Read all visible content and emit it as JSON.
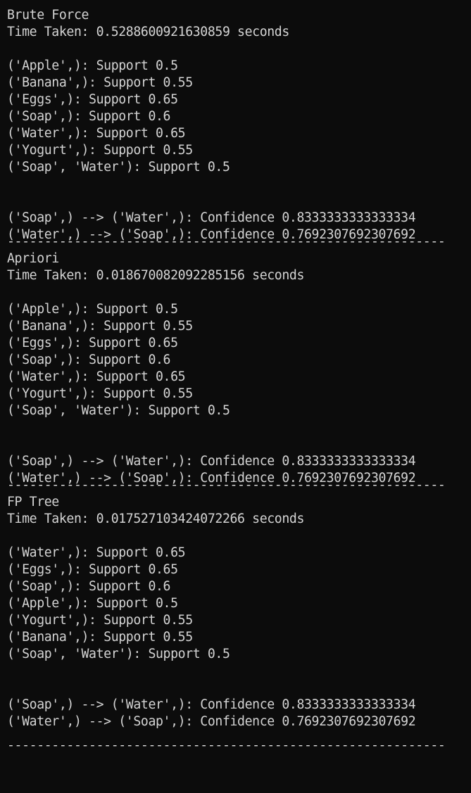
{
  "separator": "-----------------------------------------------------------",
  "sections": [
    {
      "name": "Brute Force",
      "time": "Time Taken: 0.5288600921630859 seconds",
      "supports": [
        "('Apple',): Support 0.5",
        "('Banana',): Support 0.55",
        "('Eggs',): Support 0.65",
        "('Soap',): Support 0.6",
        "('Water',): Support 0.65",
        "('Yogurt',): Support 0.55",
        "('Soap', 'Water'): Support 0.5"
      ],
      "rules": [
        "('Soap',) --> ('Water',): Confidence 0.8333333333333334",
        "('Water',) --> ('Soap',): Confidence 0.7692307692307692"
      ]
    },
    {
      "name": "Apriori",
      "time": "Time Taken: 0.018670082092285156 seconds",
      "supports": [
        "('Apple',): Support 0.5",
        "('Banana',): Support 0.55",
        "('Eggs',): Support 0.65",
        "('Soap',): Support 0.6",
        "('Water',): Support 0.65",
        "('Yogurt',): Support 0.55",
        "('Soap', 'Water'): Support 0.5"
      ],
      "rules": [
        "('Soap',) --> ('Water',): Confidence 0.8333333333333334",
        "('Water',) --> ('Soap',): Confidence 0.7692307692307692"
      ]
    },
    {
      "name": "FP Tree",
      "time": "Time Taken: 0.017527103424072266 seconds",
      "supports": [
        "('Water',): Support 0.65",
        "('Eggs',): Support 0.65",
        "('Soap',): Support 0.6",
        "('Apple',): Support 0.5",
        "('Yogurt',): Support 0.55",
        "('Banana',): Support 0.55",
        "('Soap', 'Water'): Support 0.5"
      ],
      "rules": [
        "('Soap',) --> ('Water',): Confidence 0.8333333333333334",
        "('Water',) --> ('Soap',): Confidence 0.7692307692307692"
      ]
    }
  ]
}
